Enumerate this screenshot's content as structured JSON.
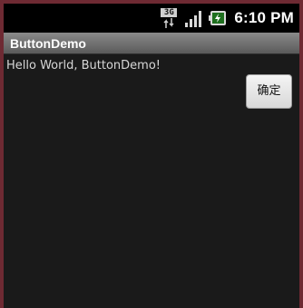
{
  "status_bar": {
    "network_badge": "3G",
    "time": "6:10 PM"
  },
  "app": {
    "title": "ButtonDemo"
  },
  "content": {
    "hello_text": "Hello World, ButtonDemo!",
    "confirm_button_label": "确定"
  },
  "icons": {
    "network": "3g-data-icon",
    "signal": "signal-strength-icon",
    "battery": "battery-charging-icon"
  },
  "colors": {
    "background": "#1a1a1a",
    "title_bar": "#6e6e6e",
    "text": "#d7d7d7",
    "button_face": "#e8e8e8",
    "frame": "#6e2a33"
  }
}
